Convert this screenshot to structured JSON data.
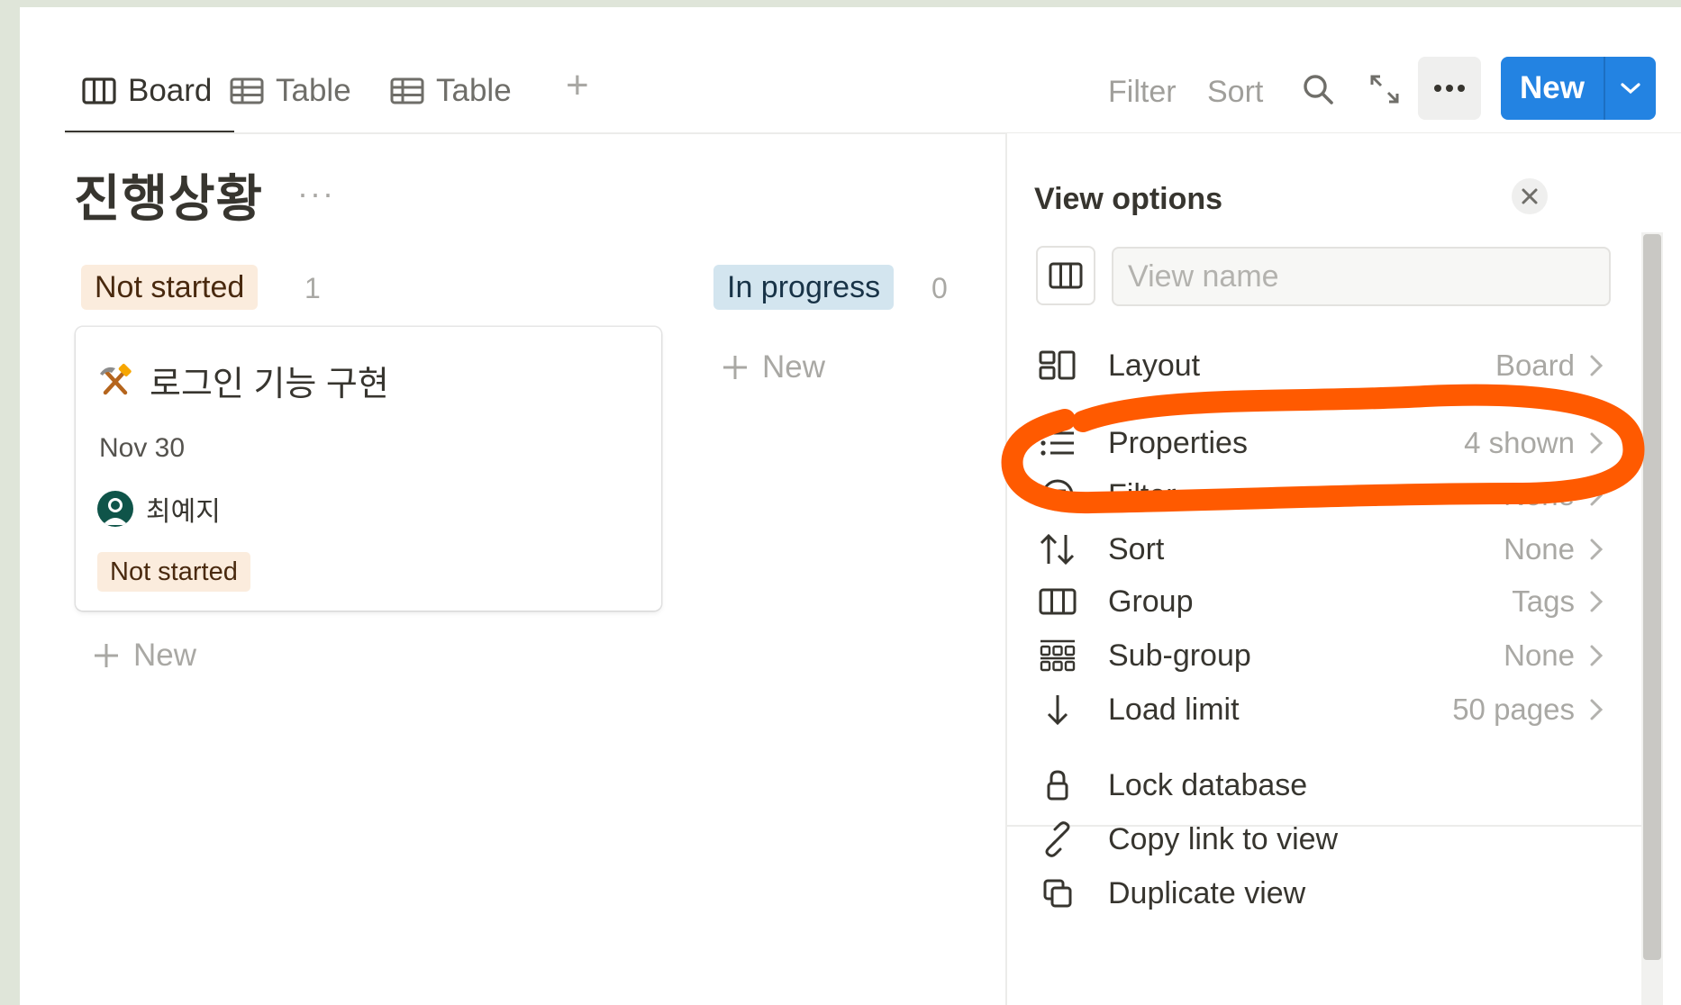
{
  "tabs": [
    {
      "label": "Board",
      "icon": "board-icon",
      "active": true
    },
    {
      "label": "Table",
      "icon": "table-icon",
      "active": false
    },
    {
      "label": "Table",
      "icon": "table-icon",
      "active": false
    }
  ],
  "toolbar": {
    "add_tab": "+",
    "filter_label": "Filter",
    "sort_label": "Sort",
    "new_label": "New"
  },
  "page": {
    "title": "진행상황",
    "more": "···"
  },
  "columns": [
    {
      "label": "Not started",
      "count": "1",
      "color": "#fbecdd",
      "add_label": "New"
    },
    {
      "label": "In progress",
      "count": "0",
      "color": "#d3e5ef",
      "add_label": "New"
    }
  ],
  "card": {
    "icon": "hammer-pick-icon",
    "title": "로그인 기능 구현",
    "date": "Nov 30",
    "person": "최예지",
    "status": "Not started"
  },
  "view_options": {
    "title": "View options",
    "name_placeholder": "View name",
    "items": [
      {
        "label": "Layout",
        "value": "Board",
        "icon": "layout-icon"
      },
      {
        "label": "Properties",
        "value": "4 shown",
        "icon": "list-icon"
      },
      {
        "label": "Filter",
        "value": "None",
        "icon": "filter-icon"
      },
      {
        "label": "Sort",
        "value": "None",
        "icon": "sort-icon"
      },
      {
        "label": "Group",
        "value": "Tags",
        "icon": "group-icon"
      },
      {
        "label": "Sub-group",
        "value": "None",
        "icon": "subgroup-icon"
      },
      {
        "label": "Load limit",
        "value": "50 pages",
        "icon": "arrow-down-icon"
      }
    ],
    "actions": [
      {
        "label": "Lock database",
        "icon": "lock-icon"
      },
      {
        "label": "Copy link to view",
        "icon": "link-icon"
      },
      {
        "label": "Duplicate view",
        "icon": "duplicate-icon"
      }
    ]
  },
  "colors": {
    "accent": "#2383e2",
    "highlight": "#ff5a00"
  }
}
